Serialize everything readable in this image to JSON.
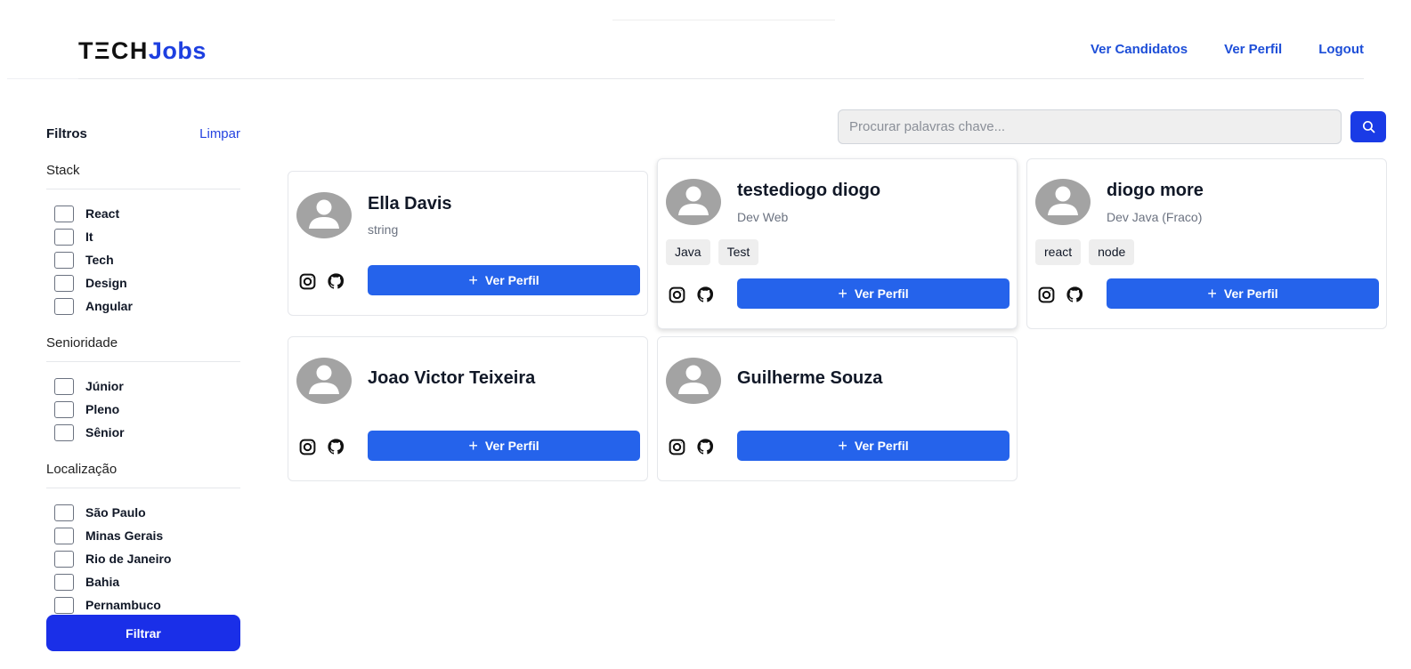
{
  "header": {
    "logo_part1": "TΞCH",
    "logo_part2": "Jobs",
    "nav": [
      "Ver Candidatos",
      "Ver Perfil",
      "Logout"
    ]
  },
  "sidebar": {
    "title": "Filtros",
    "clear_label": "Limpar",
    "sections": [
      {
        "title": "Stack",
        "options": [
          "React",
          "It",
          "Tech",
          "Design",
          "Angular"
        ]
      },
      {
        "title": "Senioridade",
        "options": [
          "Júnior",
          "Pleno",
          "Sênior"
        ]
      },
      {
        "title": "Localização",
        "options": [
          "São Paulo",
          "Minas Gerais",
          "Rio de Janeiro",
          "Bahia",
          "Pernambuco"
        ]
      }
    ],
    "filter_button": "Filtrar"
  },
  "search": {
    "placeholder": "Procurar palavras chave..."
  },
  "cards": [
    {
      "name": "Ella Davis",
      "role": "string",
      "tags": [],
      "button": "Ver Perfil"
    },
    {
      "name": "testediogo diogo",
      "role": "Dev Web",
      "tags": [
        "Java",
        "Test"
      ],
      "button": "Ver Perfil"
    },
    {
      "name": "diogo more",
      "role": "Dev Java (Fraco)",
      "tags": [
        "react",
        "node"
      ],
      "button": "Ver Perfil"
    },
    {
      "name": "Joao Victor Teixeira",
      "role": "",
      "tags": [],
      "button": "Ver Perfil"
    },
    {
      "name": "Guilherme Souza",
      "role": "",
      "tags": [],
      "button": "Ver Perfil"
    }
  ],
  "colors": {
    "primary_button": "#2563eb",
    "filter_button": "#1a2fe8",
    "nav_link": "#1d4ed8",
    "logo_accent": "#1d3fe0"
  }
}
